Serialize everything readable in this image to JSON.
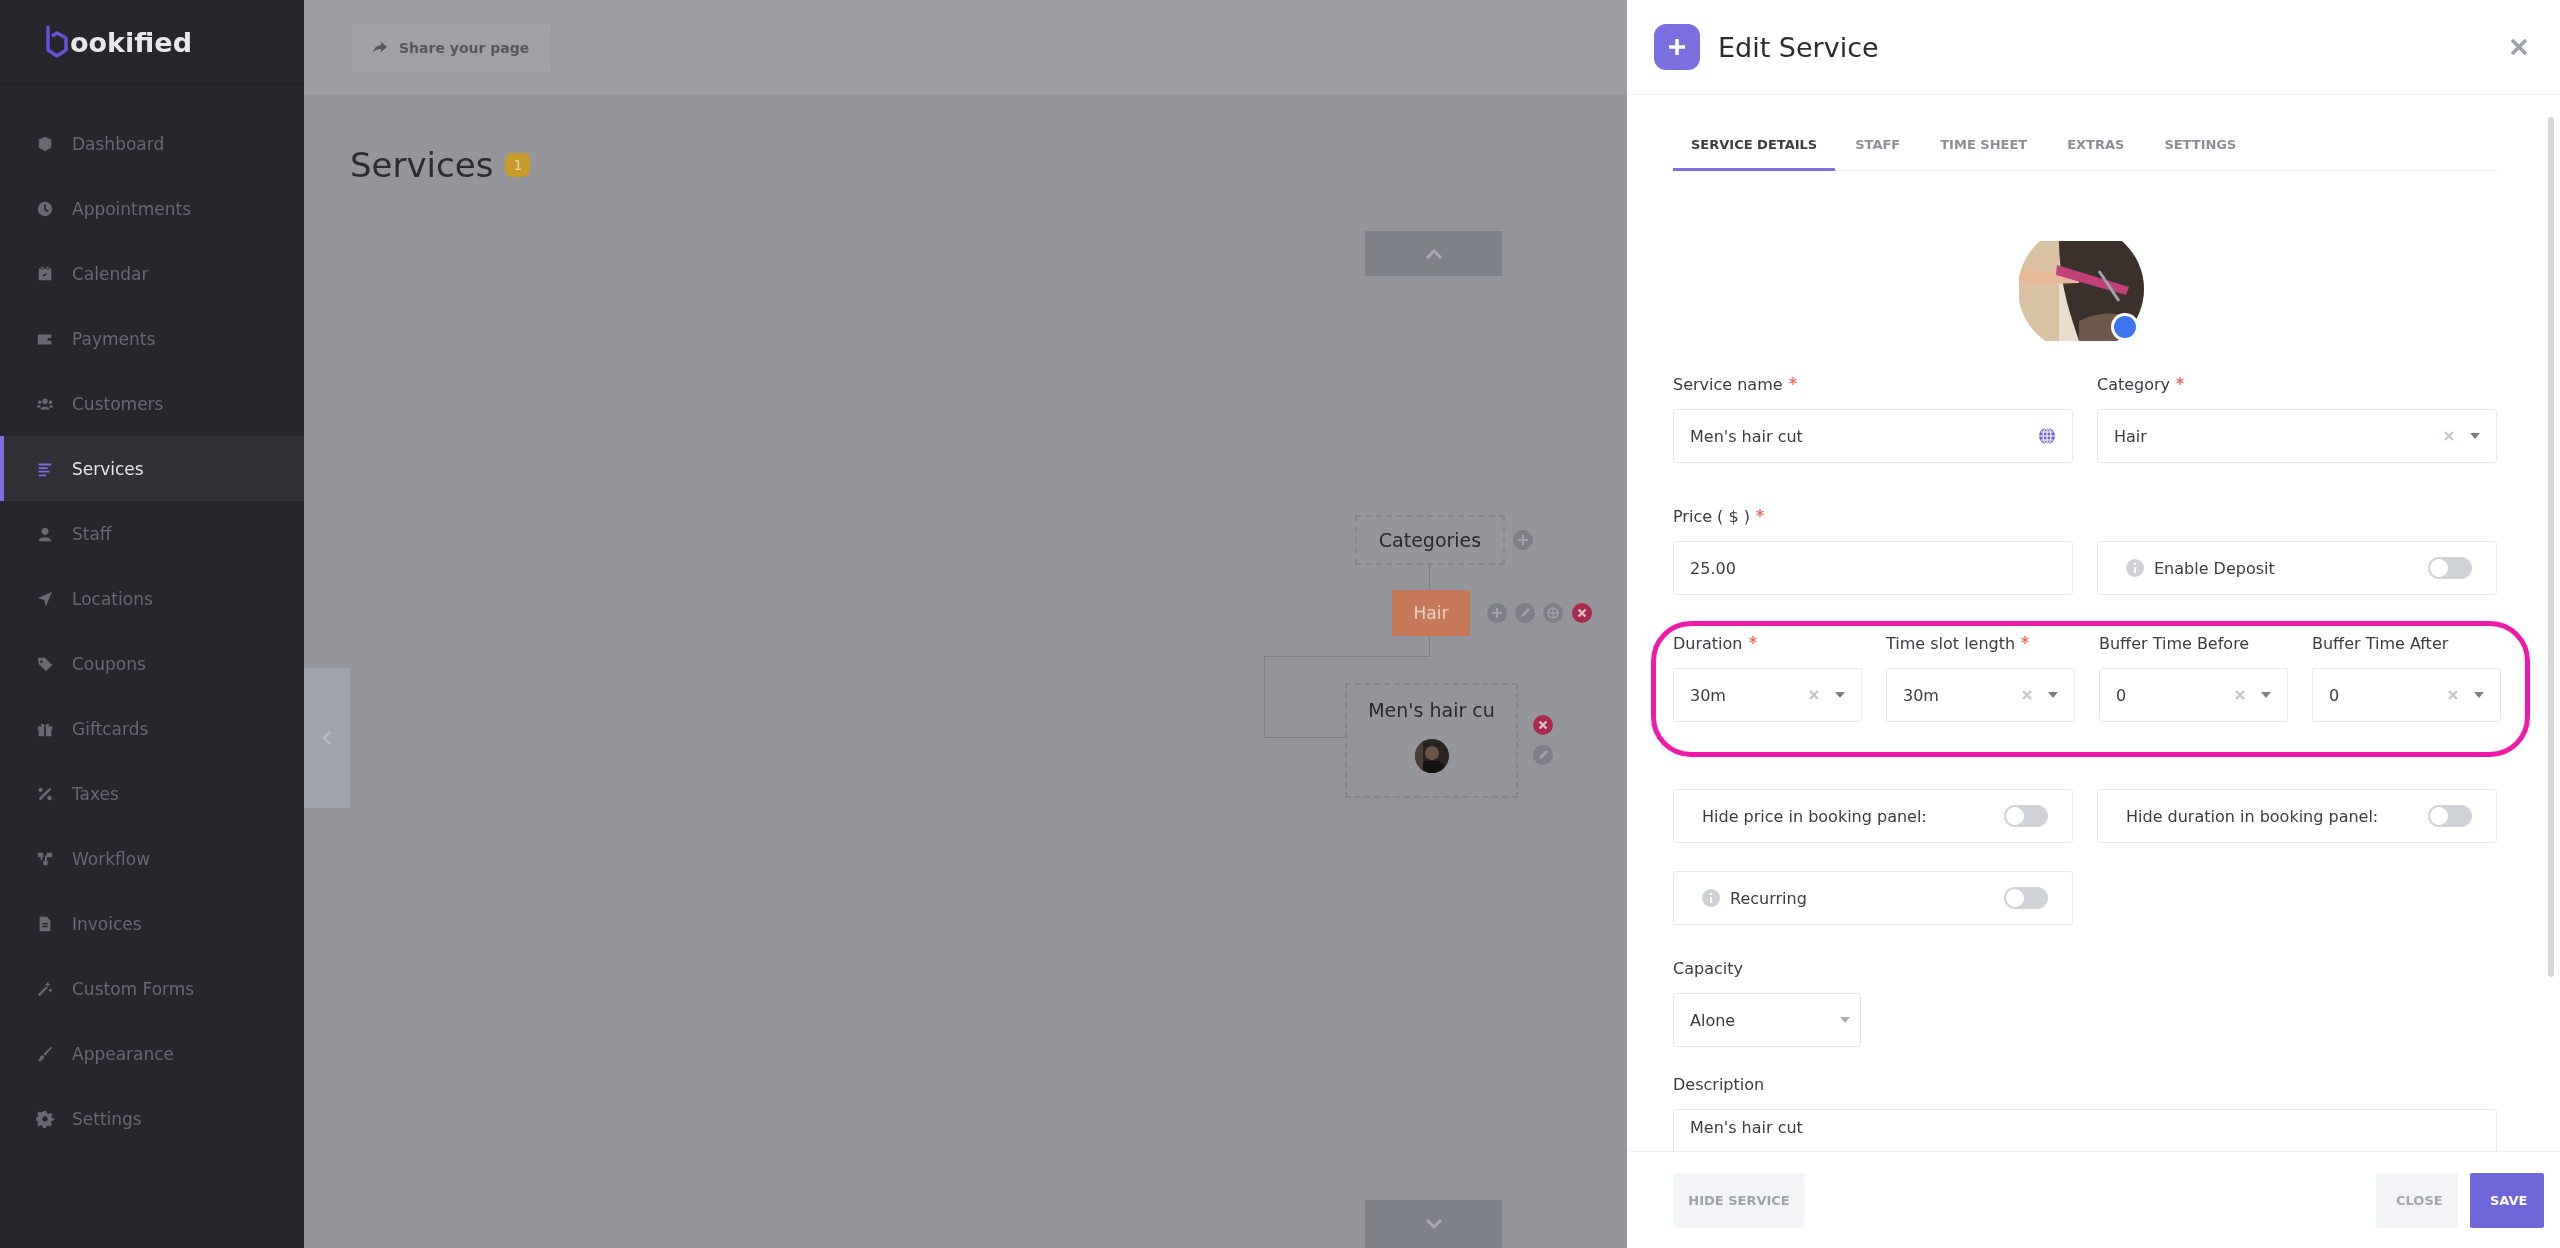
{
  "sidebar": {
    "logo": "ookified",
    "items": [
      {
        "label": "Dashboard",
        "selected": false
      },
      {
        "label": "Appointments",
        "selected": false
      },
      {
        "label": "Calendar",
        "selected": false
      },
      {
        "label": "Payments",
        "selected": false
      },
      {
        "label": "Customers",
        "selected": false
      },
      {
        "label": "Services",
        "selected": true
      },
      {
        "label": "Staff",
        "selected": false
      },
      {
        "label": "Locations",
        "selected": false
      },
      {
        "label": "Coupons",
        "selected": false
      },
      {
        "label": "Giftcards",
        "selected": false
      },
      {
        "label": "Taxes",
        "selected": false
      },
      {
        "label": "Workflow",
        "selected": false
      },
      {
        "label": "Invoices",
        "selected": false
      },
      {
        "label": "Custom Forms",
        "selected": false
      },
      {
        "label": "Appearance",
        "selected": false
      },
      {
        "label": "Settings",
        "selected": false
      }
    ]
  },
  "topbar": {
    "share_button": "Share your page"
  },
  "page": {
    "title": "Services",
    "count": "1"
  },
  "tree": {
    "root": "Categories",
    "categories": [
      {
        "label": "Hair",
        "children": [
          {
            "label": "Men's hair cu"
          }
        ]
      }
    ]
  },
  "panel": {
    "title": "Edit Service",
    "tabs": [
      {
        "label": "SERVICE DETAILS",
        "selected": true
      },
      {
        "label": "STAFF",
        "selected": false
      },
      {
        "label": "TIME SHEET",
        "selected": false
      },
      {
        "label": "EXTRAS",
        "selected": false
      },
      {
        "label": "SETTINGS",
        "selected": false
      }
    ],
    "service_name": {
      "label": "Service name",
      "required": true,
      "value": "Men's hair cut"
    },
    "category": {
      "label": "Category",
      "required": true,
      "value": "Hair"
    },
    "price": {
      "label": "Price ( $ )",
      "required": true,
      "value": "25.00"
    },
    "deposit": {
      "label": "Enable Deposit",
      "on": false
    },
    "timing": [
      {
        "label": "Duration",
        "required": true,
        "value": "30m"
      },
      {
        "label": "Time slot length",
        "required": true,
        "value": "30m"
      },
      {
        "label": "Buffer Time Before",
        "required": false,
        "value": "0"
      },
      {
        "label": "Buffer Time After",
        "required": false,
        "value": "0"
      }
    ],
    "toggles": [
      {
        "label": "Hide price in booking panel:",
        "on": false
      },
      {
        "label": "Hide duration in booking panel:",
        "on": false
      }
    ],
    "recurring": {
      "label": "Recurring",
      "on": false
    },
    "capacity": {
      "label": "Capacity",
      "value": "Alone"
    },
    "description": {
      "label": "Description",
      "value": "Men's hair cut"
    },
    "footer": {
      "hide_button": "HIDE SERVICE",
      "close_button": "CLOSE",
      "save_button": "SAVE"
    }
  }
}
